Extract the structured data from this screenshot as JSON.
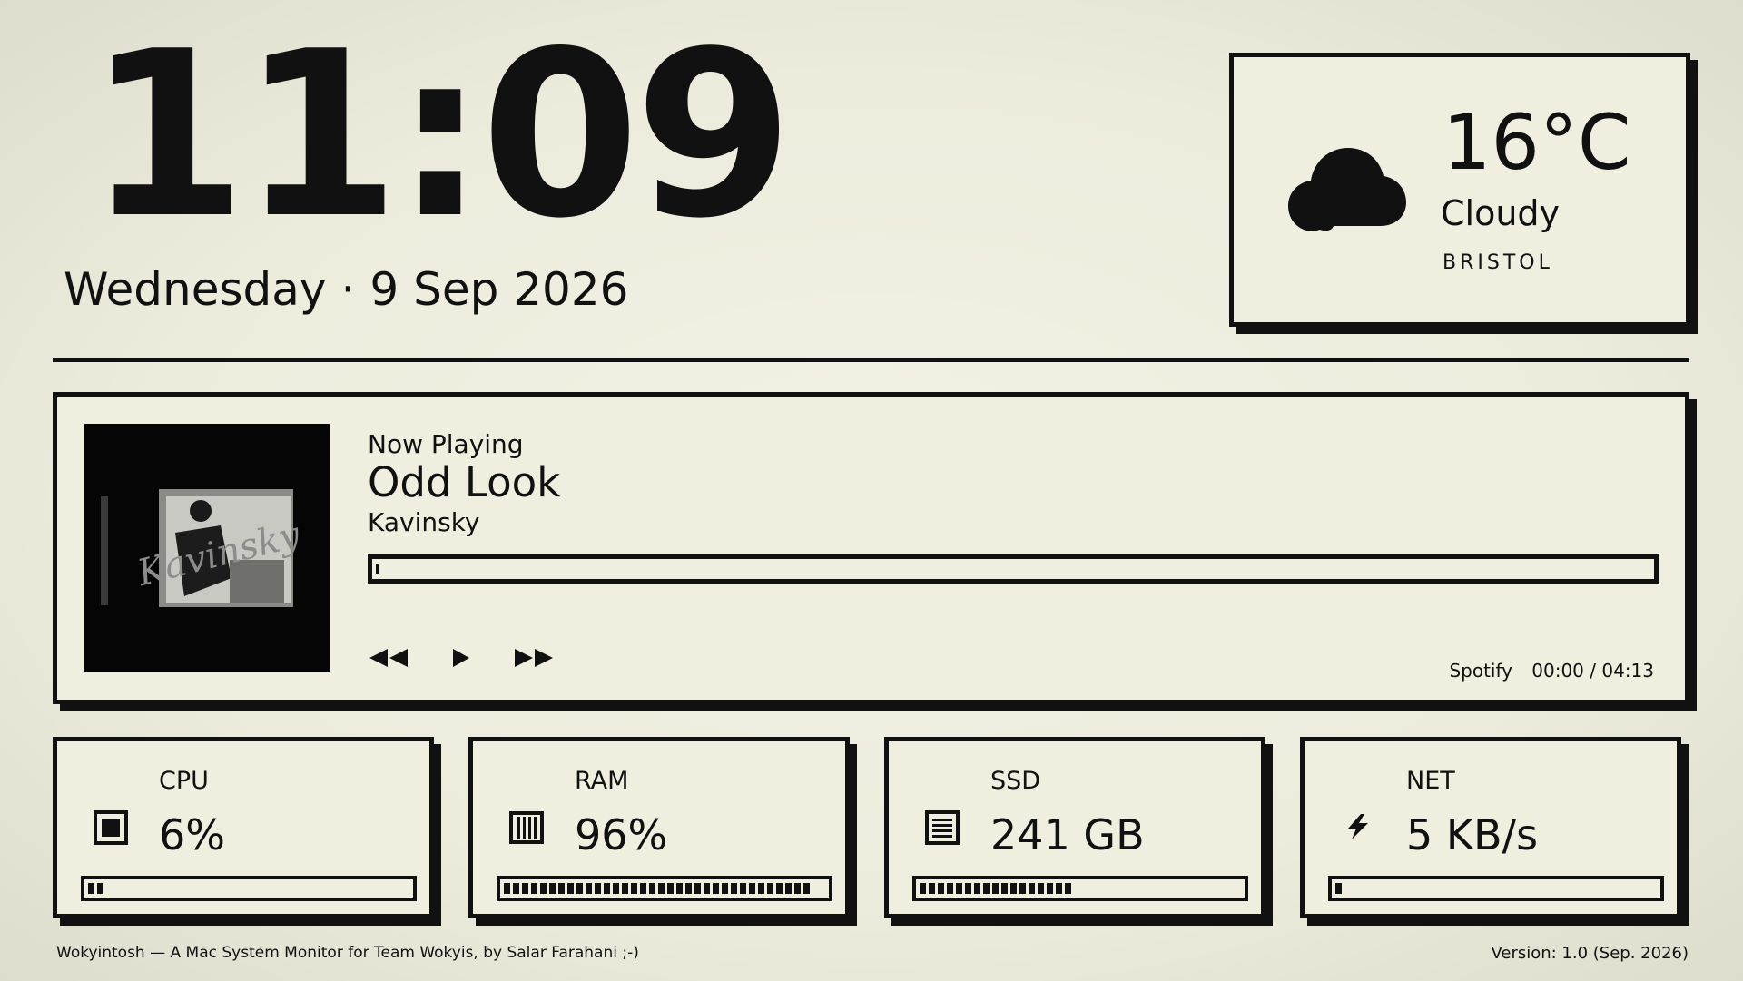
{
  "clock": {
    "time": "11:09",
    "weekday": "Wednesday",
    "separator": "·",
    "date": "9 Sep 2026"
  },
  "weather": {
    "temperature": "16°C",
    "condition": "Cloudy",
    "city": "BRISTOL",
    "icon": "cloud-icon"
  },
  "player": {
    "label": "Now Playing",
    "title": "Odd Look",
    "artist": "Kavinsky",
    "album_art_text": "Kavinsky",
    "progress_fraction": 0.0,
    "source": "Spotify",
    "time": "00:00 / 04:13",
    "controls": [
      "previous-icon",
      "play-icon",
      "next-icon"
    ]
  },
  "stats": {
    "cpu": {
      "label": "CPU",
      "value": "6%",
      "fill_fraction": 0.06,
      "icon": "cpu-chip-icon"
    },
    "ram": {
      "label": "RAM",
      "value": "96%",
      "fill_fraction": 0.96,
      "icon": "memory-icon"
    },
    "ssd": {
      "label": "SSD",
      "value": "241 GB",
      "fill_fraction": 0.47,
      "icon": "storage-icon"
    },
    "net": {
      "label": "NET",
      "value": "5 KB/s",
      "fill_fraction": 0.04,
      "icon": "lightning-icon"
    }
  },
  "footer": {
    "left": "Wokyintosh — A Mac System Monitor for Team Wokyis, by Salar Farahani ;-)",
    "right": "Version: 1.0 (Sep. 2026)"
  }
}
